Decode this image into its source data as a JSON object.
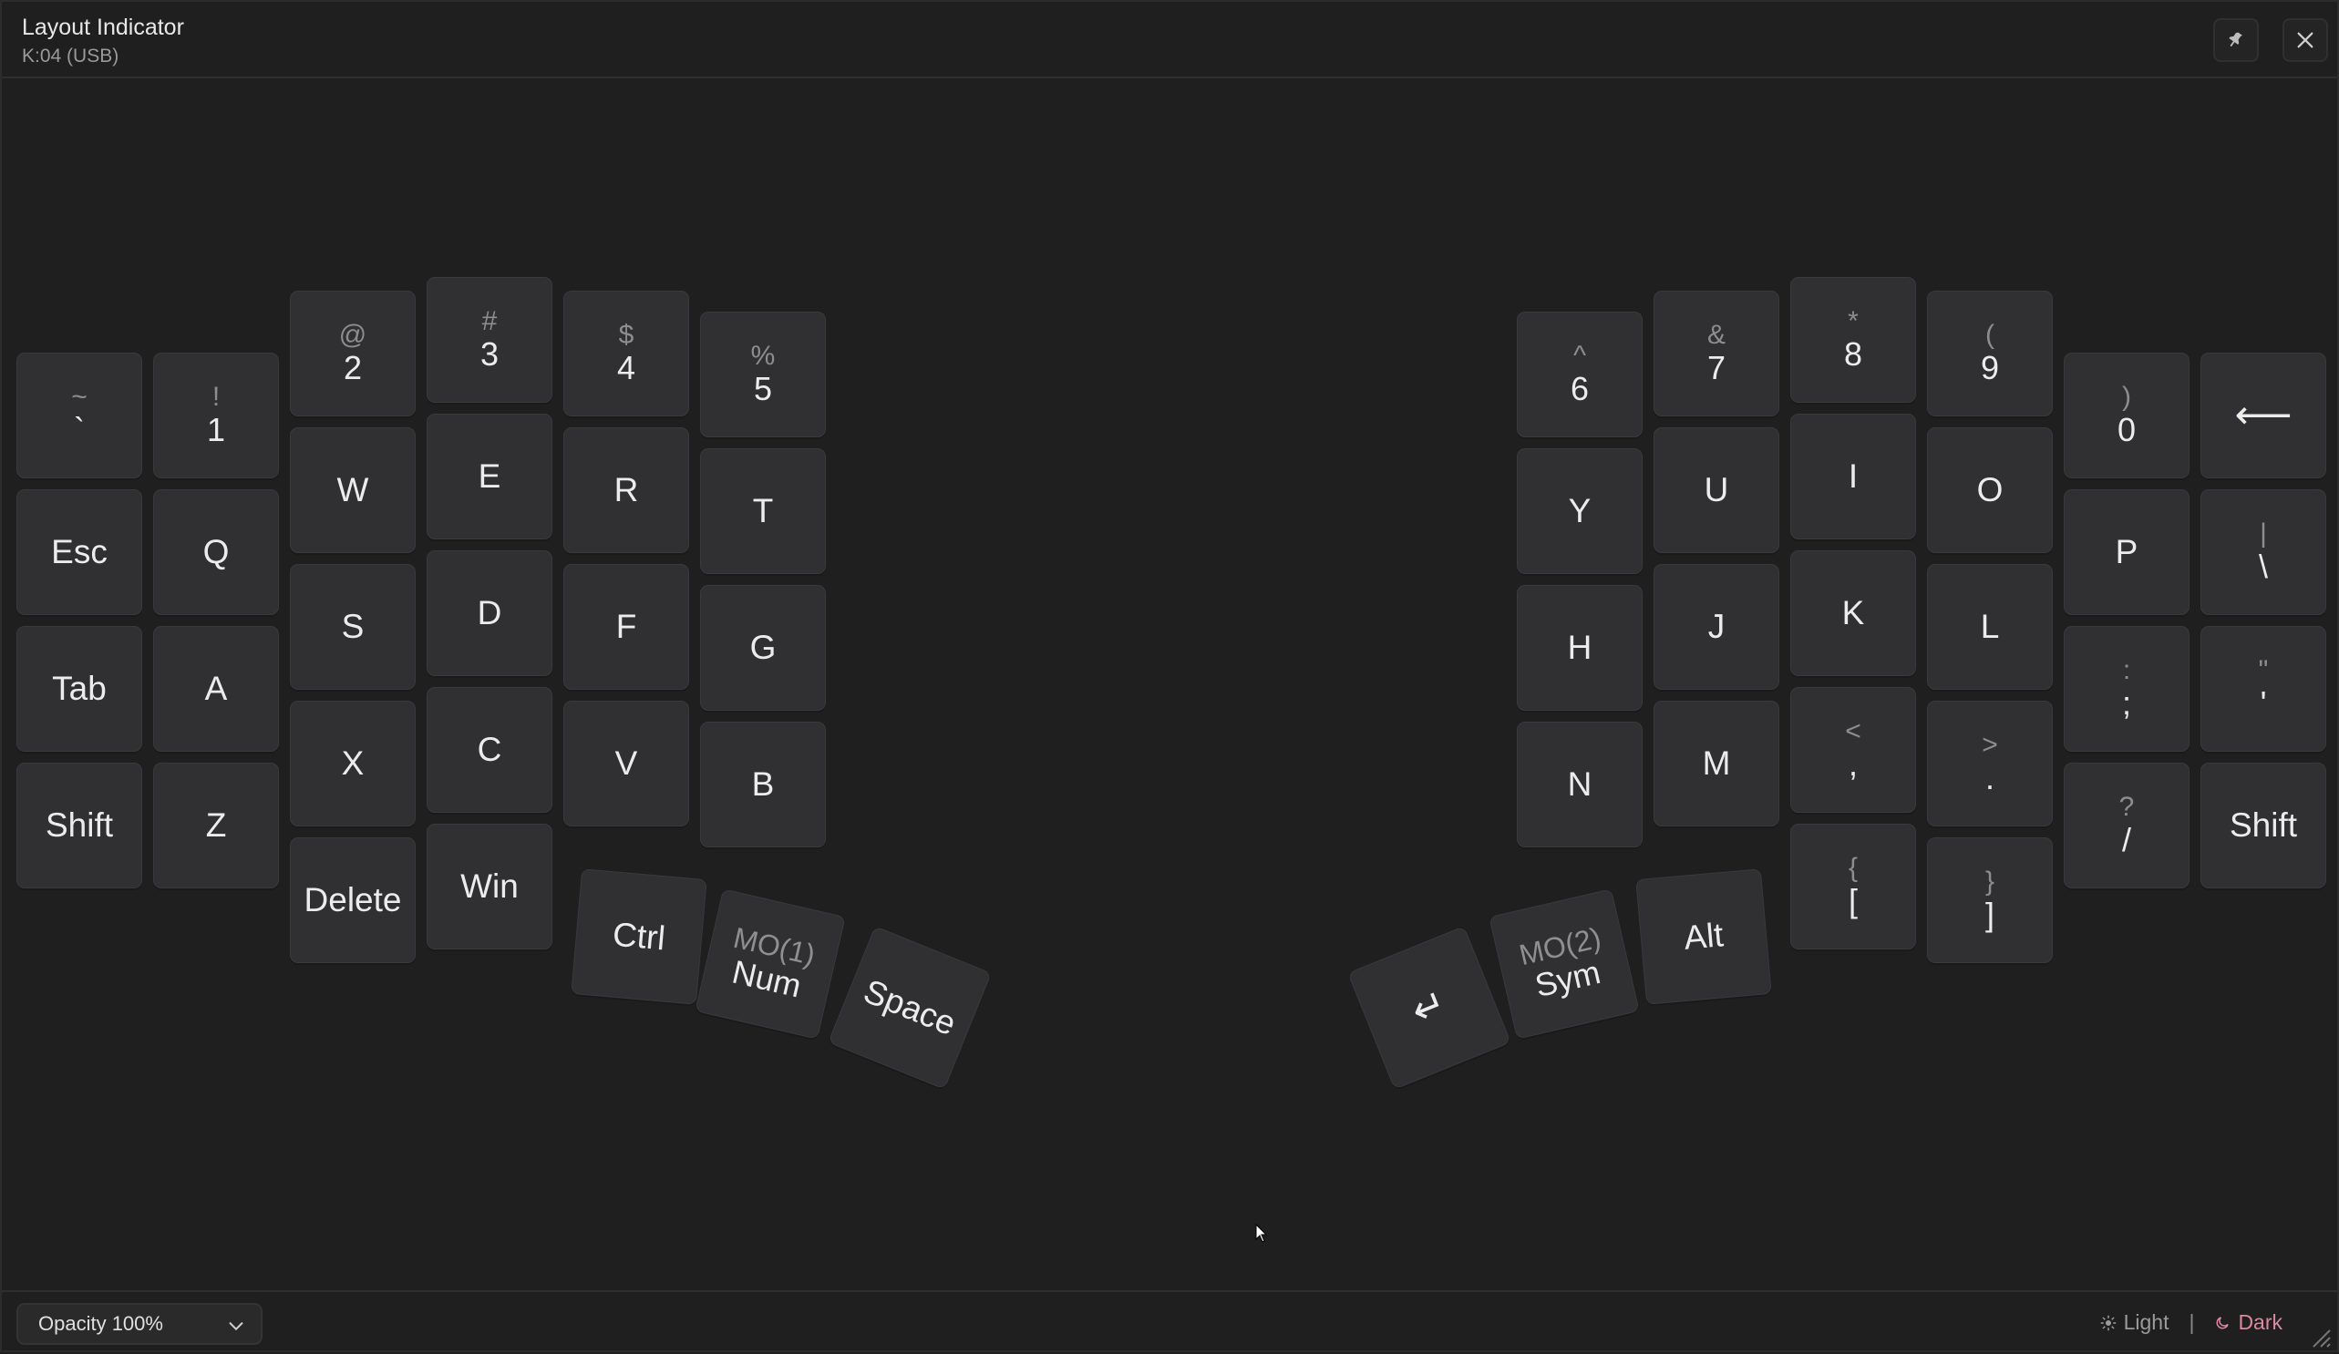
{
  "window": {
    "title": "Layout Indicator",
    "subtitle": "K:04 (USB)",
    "pin_icon": "pin-icon",
    "close_icon": "close-icon"
  },
  "keys": {
    "tilde": {
      "shift": "~",
      "main": "`"
    },
    "k1": {
      "shift": "!",
      "main": "1"
    },
    "k2": {
      "shift": "@",
      "main": "2"
    },
    "k3": {
      "shift": "#",
      "main": "3"
    },
    "k4": {
      "shift": "$",
      "main": "4"
    },
    "k5": {
      "shift": "%",
      "main": "5"
    },
    "esc": {
      "main": "Esc"
    },
    "q": {
      "main": "Q"
    },
    "w": {
      "main": "W"
    },
    "e": {
      "main": "E"
    },
    "r": {
      "main": "R"
    },
    "t": {
      "main": "T"
    },
    "tab": {
      "main": "Tab"
    },
    "a": {
      "main": "A"
    },
    "s": {
      "main": "S"
    },
    "d": {
      "main": "D"
    },
    "f": {
      "main": "F"
    },
    "g": {
      "main": "G"
    },
    "lshift": {
      "main": "Shift"
    },
    "z": {
      "main": "Z"
    },
    "x": {
      "main": "X"
    },
    "c": {
      "main": "C"
    },
    "v": {
      "main": "V"
    },
    "b": {
      "main": "B"
    },
    "delete": {
      "main": "Delete"
    },
    "win": {
      "main": "Win"
    },
    "ctrl": {
      "main": "Ctrl"
    },
    "num": {
      "layer": "MO(1)",
      "main": "Num"
    },
    "space": {
      "main": "Space"
    },
    "k6": {
      "shift": "^",
      "main": "6"
    },
    "k7": {
      "shift": "&",
      "main": "7"
    },
    "k8": {
      "shift": "*",
      "main": "8"
    },
    "k9": {
      "shift": "(",
      "main": "9"
    },
    "k0": {
      "shift": ")",
      "main": "0"
    },
    "backspace": {
      "main": "⟵",
      "icon": "backspace-arrow-icon"
    },
    "y": {
      "main": "Y"
    },
    "u": {
      "main": "U"
    },
    "i": {
      "main": "I"
    },
    "o": {
      "main": "O"
    },
    "p": {
      "main": "P"
    },
    "backslash": {
      "shift": "|",
      "main": "\\"
    },
    "h": {
      "main": "H"
    },
    "j": {
      "main": "J"
    },
    "k": {
      "main": "K"
    },
    "l": {
      "main": "L"
    },
    "semicolon": {
      "shift": ":",
      "main": ";"
    },
    "quote": {
      "shift": "\"",
      "main": "'"
    },
    "n": {
      "main": "N"
    },
    "m": {
      "main": "M"
    },
    "comma": {
      "shift": "<",
      "main": ","
    },
    "period": {
      "shift": ">",
      "main": "."
    },
    "slash": {
      "shift": "?",
      "main": "/"
    },
    "rshift": {
      "main": "Shift"
    },
    "lbracket": {
      "shift": "{",
      "main": "["
    },
    "rbracket": {
      "shift": "}",
      "main": "]"
    },
    "alt": {
      "main": "Alt"
    },
    "sym": {
      "layer": "MO(2)",
      "main": "Sym"
    },
    "enter": {
      "main": "↵",
      "icon": "enter-icon"
    }
  },
  "footer": {
    "opacity_label": "Opacity 100%",
    "light_label": "Light",
    "separator": "|",
    "dark_label": "Dark",
    "active_theme": "Dark",
    "accent_color": "#d98aa0"
  }
}
